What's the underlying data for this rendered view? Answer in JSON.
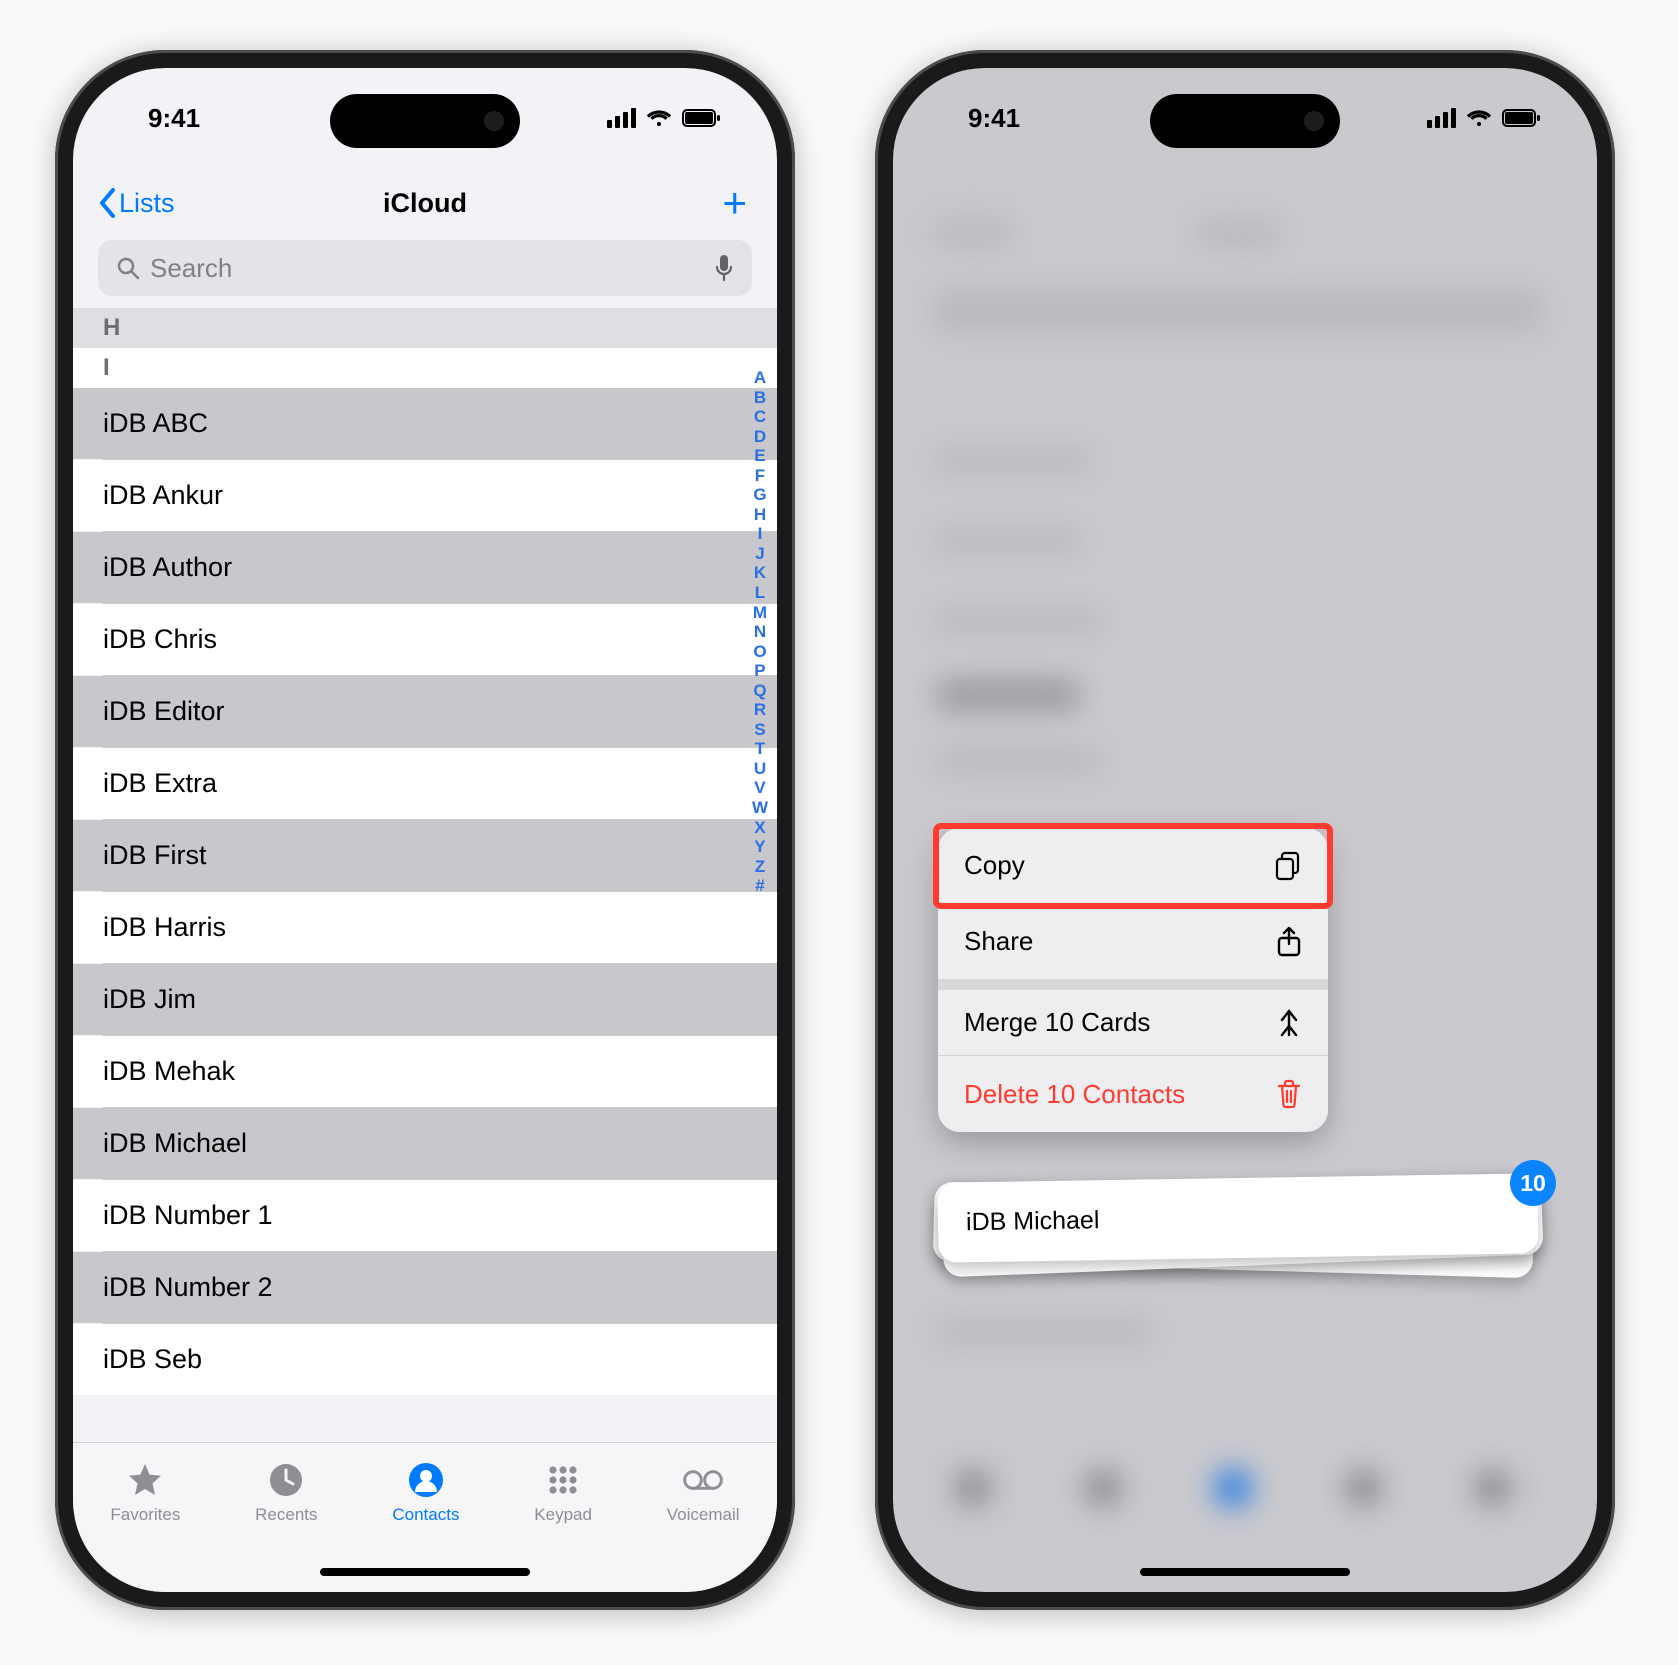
{
  "colors": {
    "accent": "#007aff",
    "danger": "#ff3b30",
    "badge": "#0a84ff"
  },
  "status": {
    "time": "9:41"
  },
  "nav": {
    "back": "Lists",
    "title": "iCloud",
    "add_glyph": "+"
  },
  "search": {
    "placeholder": "Search"
  },
  "sections": {
    "h": {
      "letter": "H"
    },
    "i": {
      "letter": "I"
    }
  },
  "contacts": [
    {
      "name": "iDB ABC",
      "selected": true
    },
    {
      "name": "iDB Ankur",
      "selected": false
    },
    {
      "name": "iDB Author",
      "selected": true
    },
    {
      "name": "iDB Chris",
      "selected": false
    },
    {
      "name": "iDB Editor",
      "selected": true
    },
    {
      "name": "iDB Extra",
      "selected": false
    },
    {
      "name": "iDB First",
      "selected": true
    },
    {
      "name": "iDB Harris",
      "selected": false
    },
    {
      "name": "iDB Jim",
      "selected": true
    },
    {
      "name": "iDB Mehak",
      "selected": false
    },
    {
      "name": "iDB Michael",
      "selected": true
    },
    {
      "name": "iDB Number 1",
      "selected": false
    },
    {
      "name": "iDB Number 2",
      "selected": true
    },
    {
      "name": "iDB Seb",
      "selected": false
    }
  ],
  "index_letters": [
    "A",
    "B",
    "C",
    "D",
    "E",
    "F",
    "G",
    "H",
    "I",
    "J",
    "K",
    "L",
    "M",
    "N",
    "O",
    "P",
    "Q",
    "R",
    "S",
    "T",
    "U",
    "V",
    "W",
    "X",
    "Y",
    "Z",
    "#"
  ],
  "tabs": [
    {
      "id": "favorites",
      "label": "Favorites",
      "active": false
    },
    {
      "id": "recents",
      "label": "Recents",
      "active": false
    },
    {
      "id": "contacts",
      "label": "Contacts",
      "active": true
    },
    {
      "id": "keypad",
      "label": "Keypad",
      "active": false
    },
    {
      "id": "voicemail",
      "label": "Voicemail",
      "active": false
    }
  ],
  "context_menu": {
    "copy": {
      "label": "Copy"
    },
    "share": {
      "label": "Share"
    },
    "merge": {
      "label": "Merge 10 Cards"
    },
    "delete": {
      "label": "Delete 10 Contacts"
    }
  },
  "stack": {
    "top_label": "iDB Michael",
    "badge": "10"
  }
}
